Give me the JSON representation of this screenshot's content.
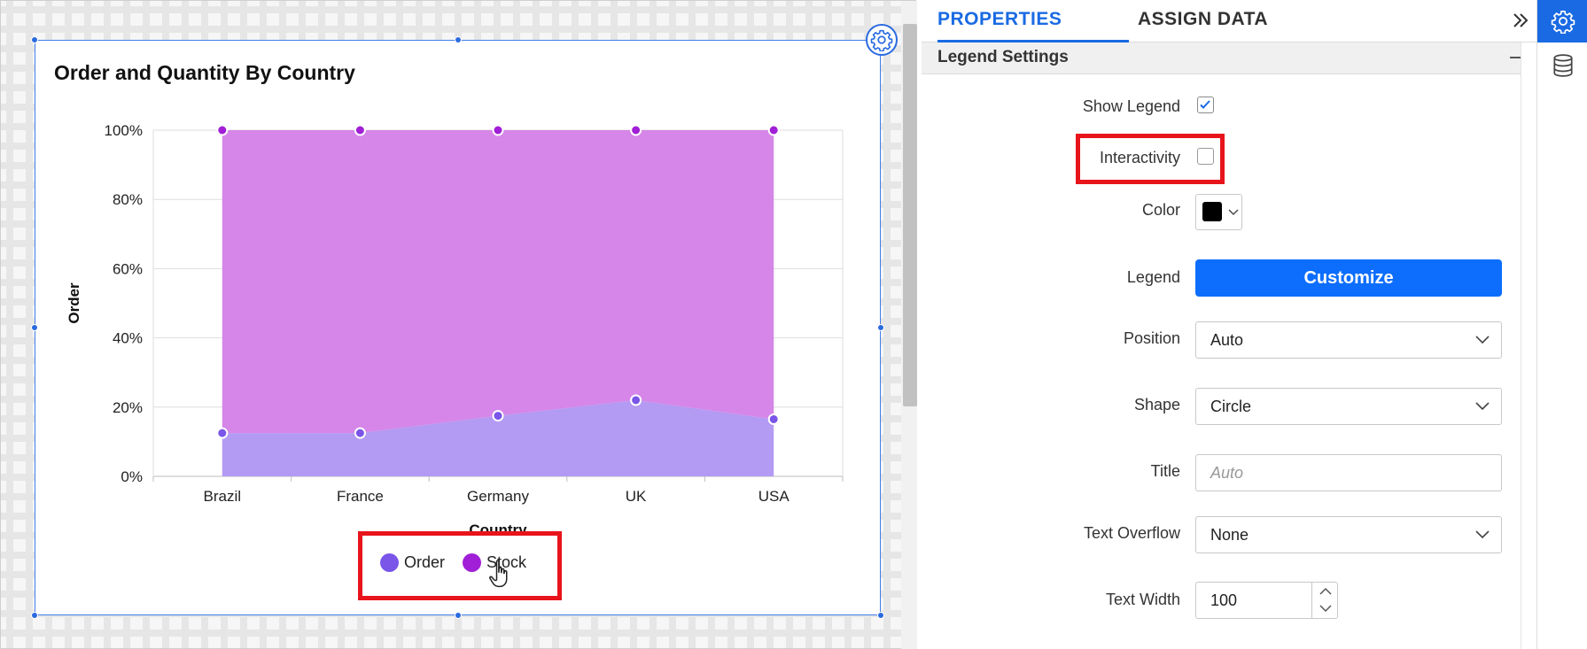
{
  "chart_widget": {
    "title": "Order and Quantity By Country"
  },
  "chart_data": {
    "type": "area",
    "title": "Order and Quantity By Country",
    "xlabel": "Country",
    "ylabel": "Order",
    "categories": [
      "Brazil",
      "France",
      "Germany",
      "UK",
      "USA"
    ],
    "y_ticks": [
      "0%",
      "20%",
      "40%",
      "60%",
      "80%",
      "100%"
    ],
    "ylim": [
      0,
      100
    ],
    "stacking": "100%",
    "grid": true,
    "legend_position": "bottom",
    "series": [
      {
        "name": "Order",
        "color": "#7a55e8",
        "fill": "#b39af3",
        "values": [
          12.5,
          12.5,
          17.5,
          22,
          16.5
        ]
      },
      {
        "name": "Stock",
        "color": "#a11fd6",
        "fill": "#d586e8",
        "values": [
          87.5,
          87.5,
          82.5,
          78,
          83.5
        ]
      }
    ]
  },
  "panel": {
    "tabs": [
      {
        "label": "PROPERTIES",
        "active": true
      },
      {
        "label": "ASSIGN DATA",
        "active": false
      }
    ],
    "section_title": "Legend Settings",
    "show_legend": {
      "label": "Show Legend",
      "checked": true
    },
    "interactivity": {
      "label": "Interactivity",
      "checked": false
    },
    "color": {
      "label": "Color",
      "value": "#000000"
    },
    "legend": {
      "label": "Legend",
      "button_label": "Customize"
    },
    "position": {
      "label": "Position",
      "value": "Auto"
    },
    "shape": {
      "label": "Shape",
      "value": "Circle"
    },
    "title": {
      "label": "Title",
      "placeholder": "Auto"
    },
    "text_overflow": {
      "label": "Text Overflow",
      "value": "None"
    },
    "text_width": {
      "label": "Text Width",
      "value": "100"
    }
  },
  "rail": {
    "items": [
      {
        "icon": "gear-icon",
        "active": true
      },
      {
        "icon": "database-icon",
        "active": false
      }
    ]
  },
  "colors": {
    "accent": "#1a6ae3",
    "primary_button": "#0d6efd",
    "highlight": "#e8141b"
  }
}
